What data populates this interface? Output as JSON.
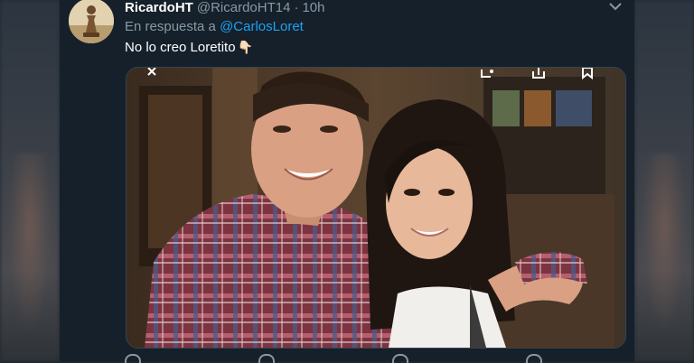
{
  "tweet": {
    "display_name": "RicardoHT",
    "handle": "@RicardoHT14",
    "separator": "·",
    "time": "10h",
    "reply_prefix": "En respuesta a",
    "reply_to": "@CarlosLoret",
    "text": "No lo creo Loretito",
    "emoji": "👇🏻"
  },
  "icons": {
    "avatar": "chess-pawn-avatar",
    "menu": "chevron-down-icon",
    "media_close": "close-icon",
    "media_actions": [
      "crop-icon",
      "share-icon",
      "bookmark-icon"
    ],
    "actions": [
      "reply-icon",
      "retweet-icon",
      "like-icon",
      "share-icon"
    ]
  },
  "colors": {
    "background": "#15202b",
    "text": "#ffffff",
    "muted": "#8899a6",
    "link": "#1da1f2"
  }
}
